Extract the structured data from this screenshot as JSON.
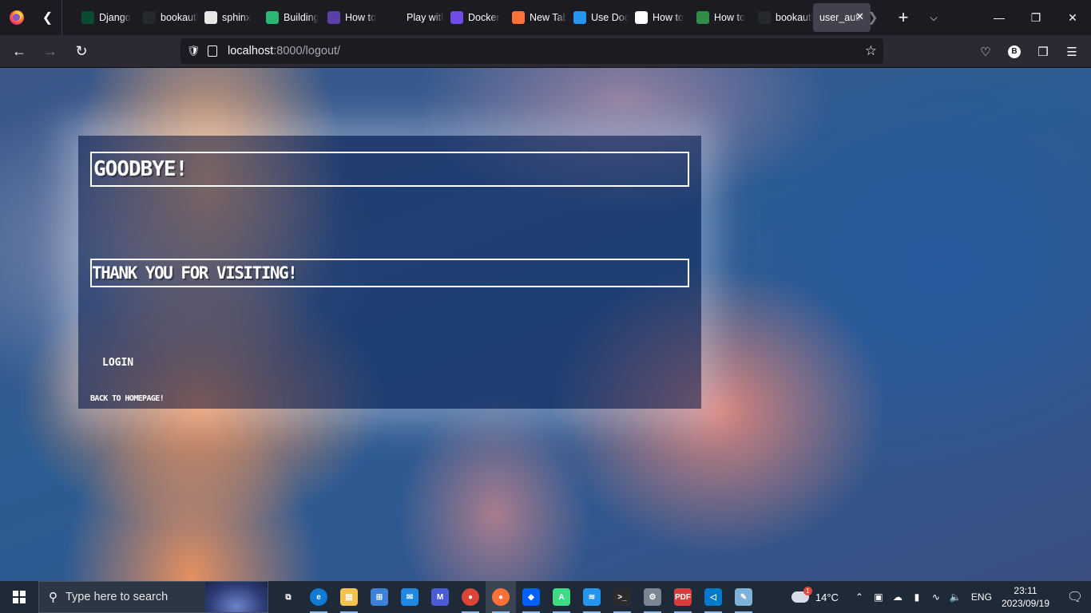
{
  "browser": {
    "tabs": [
      {
        "label": "Django",
        "icon": "django-icon",
        "color": "#0c4b33"
      },
      {
        "label": "bookauth",
        "icon": "github-icon",
        "color": "#24292e"
      },
      {
        "label": "sphinx",
        "icon": "sphinx-icon",
        "color": "#e8e8e8"
      },
      {
        "label": "Building",
        "icon": "play-icon",
        "color": "#2bb673"
      },
      {
        "label": "How to",
        "icon": "doc-icon",
        "color": "#5a3fa8"
      },
      {
        "label": "Play with Docker",
        "icon": "blank-icon",
        "color": "#1c1b22"
      },
      {
        "label": "Docker",
        "icon": "a-icon",
        "color": "#6f4ce6"
      },
      {
        "label": "New Tab",
        "icon": "firefox-icon",
        "color": "#ff7139"
      },
      {
        "label": "Use Docker",
        "icon": "docker-icon",
        "color": "#2496ed"
      },
      {
        "label": "How to",
        "icon": "chart-icon",
        "color": "#ffffff"
      },
      {
        "label": "How to",
        "icon": "gfg-icon",
        "color": "#2f8d46"
      },
      {
        "label": "bookauth",
        "icon": "github-icon",
        "color": "#24292e"
      },
      {
        "label": "user_auth",
        "icon": "none",
        "color": "#42414d",
        "active": true
      }
    ],
    "new_tab_glyph": "+",
    "url_host": "localhost",
    "url_rest": ":8000/logout/"
  },
  "page": {
    "title": "GOODBYE!",
    "message": "THANK YOU FOR VISITING!",
    "login_link": "LOGIN",
    "home_link": "BACK TO HOMEPAGE!"
  },
  "taskbar": {
    "search_placeholder": "Type here to search",
    "weather_temp": "14°C",
    "weather_badge": "1",
    "language": "ENG",
    "time": "23:11",
    "date": "2023/09/19",
    "apps": [
      {
        "name": "task-view-icon",
        "color": "#1f2a38",
        "glyph": "⧉"
      },
      {
        "name": "edge-icon",
        "color": "#0f7bd6",
        "glyph": "e"
      },
      {
        "name": "file-explorer-icon",
        "color": "#f2c14e",
        "glyph": "▤"
      },
      {
        "name": "microsoft-store-icon",
        "color": "#3b82d8",
        "glyph": "⊞"
      },
      {
        "name": "mail-icon",
        "color": "#1e88e5",
        "glyph": "✉"
      },
      {
        "name": "dev-app-icon",
        "color": "#4b5bd6",
        "glyph": "M"
      },
      {
        "name": "chrome-icon",
        "color": "#db4437",
        "glyph": "●"
      },
      {
        "name": "firefox-icon",
        "color": "#ff7139",
        "glyph": "●"
      },
      {
        "name": "dropbox-icon",
        "color": "#0061ff",
        "glyph": "◆"
      },
      {
        "name": "android-studio-icon",
        "color": "#3ddc84",
        "glyph": "A"
      },
      {
        "name": "docker-icon",
        "color": "#2496ed",
        "glyph": "≋"
      },
      {
        "name": "terminal-icon",
        "color": "#2b2b2b",
        "glyph": ">_"
      },
      {
        "name": "settings-icon",
        "color": "#7a8593",
        "glyph": "⚙"
      },
      {
        "name": "pdf-app-icon",
        "color": "#d83b3b",
        "glyph": "PDF"
      },
      {
        "name": "vscode-icon",
        "color": "#007acc",
        "glyph": "◁"
      },
      {
        "name": "notepad-icon",
        "color": "#7fb2d9",
        "glyph": "✎"
      }
    ]
  }
}
